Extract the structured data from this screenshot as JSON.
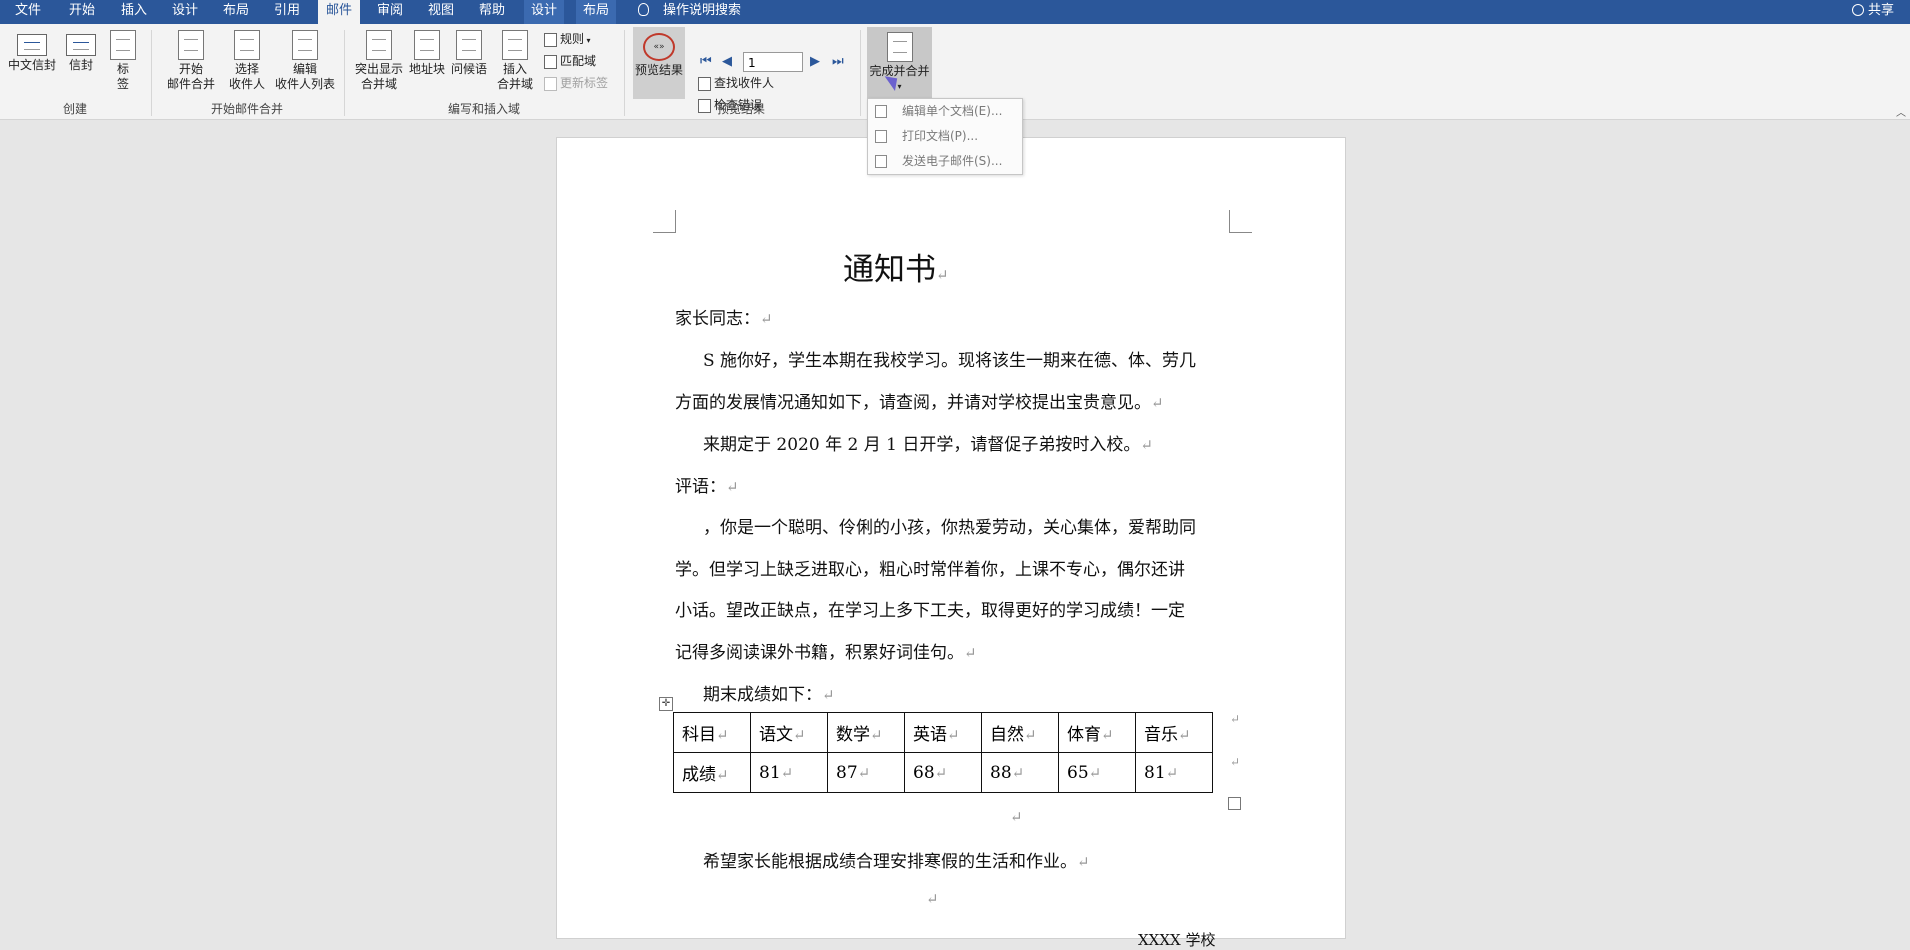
{
  "tabs": [
    {
      "label": "文件"
    },
    {
      "label": "开始"
    },
    {
      "label": "插入"
    },
    {
      "label": "设计"
    },
    {
      "label": "布局"
    },
    {
      "label": "引用"
    },
    {
      "label": "邮件"
    },
    {
      "label": "审阅"
    },
    {
      "label": "视图"
    },
    {
      "label": "帮助"
    },
    {
      "label": "设计"
    },
    {
      "label": "布局"
    }
  ],
  "search": {
    "label": "操作说明搜索"
  },
  "share": {
    "label": "共享"
  },
  "ribbon": {
    "create": {
      "label": "创建",
      "chinese_envelope": "中文信封",
      "envelope": "信封",
      "labels_line1": "标",
      "labels_line2": "签"
    },
    "start_merge": {
      "label": "开始邮件合并",
      "start_line1": "开始",
      "start_line2": "邮件合并",
      "select_line1": "选择",
      "select_line2": "收件人",
      "edit_line1": "编辑",
      "edit_line2": "收件人列表"
    },
    "write_insert": {
      "label": "编写和插入域",
      "highlight_line1": "突出显示",
      "highlight_line2": "合并域",
      "address_block": "地址块",
      "greeting": "问候语",
      "insert_line1": "插入",
      "insert_line2": "合并域",
      "rules": "规则",
      "match_fields": "匹配域",
      "update_labels": "更新标签"
    },
    "preview": {
      "label": "预览结果",
      "preview_results": "预览结果",
      "record_value": "1",
      "find_recipient": "查找收件人",
      "check_errors": "检查错误"
    },
    "finish": {
      "label_line1": "完成并合并"
    }
  },
  "dropdown": {
    "items": [
      {
        "label": "编辑单个文档(E)..."
      },
      {
        "label": "打印文档(P)..."
      },
      {
        "label": "发送电子邮件(S)..."
      }
    ]
  },
  "document": {
    "title": "通知书",
    "salutation": "家长同志：",
    "para1_line1": "S 施你好，学生本期在我校学习。现将该生一期来在德、体、劳几",
    "para1_line2": "方面的发展情况通知如下，请查阅，并请对学校提出宝贵意见。",
    "para2": "来期定于 2020 年 2 月 1 日开学，请督促子弟按时入校。",
    "comment_label": "评语：",
    "comment_line1": "，你是一个聪明、伶俐的小孩，你热爱劳动，关心集体，爱帮助同",
    "comment_line2": "学。但学习上缺乏进取心，粗心时常伴着你，上课不专心，偶尔还讲",
    "comment_line3": "小话。望改正缺点，在学习上多下工夫，取得更好的学习成绩！一定",
    "comment_line4": "记得多阅读课外书籍，积累好词佳句。",
    "scores_intro": "期末成绩如下：",
    "table": {
      "headers": [
        "科目",
        "语文",
        "数学",
        "英语",
        "自然",
        "体育",
        "音乐"
      ],
      "row": [
        "成绩",
        "81",
        "87",
        "68",
        "88",
        "65",
        "81"
      ]
    },
    "closing": "希望家长能根据成绩合理安排寒假的生活和作业。",
    "signature": "XXXX 学校",
    "para_mark": "↵"
  }
}
